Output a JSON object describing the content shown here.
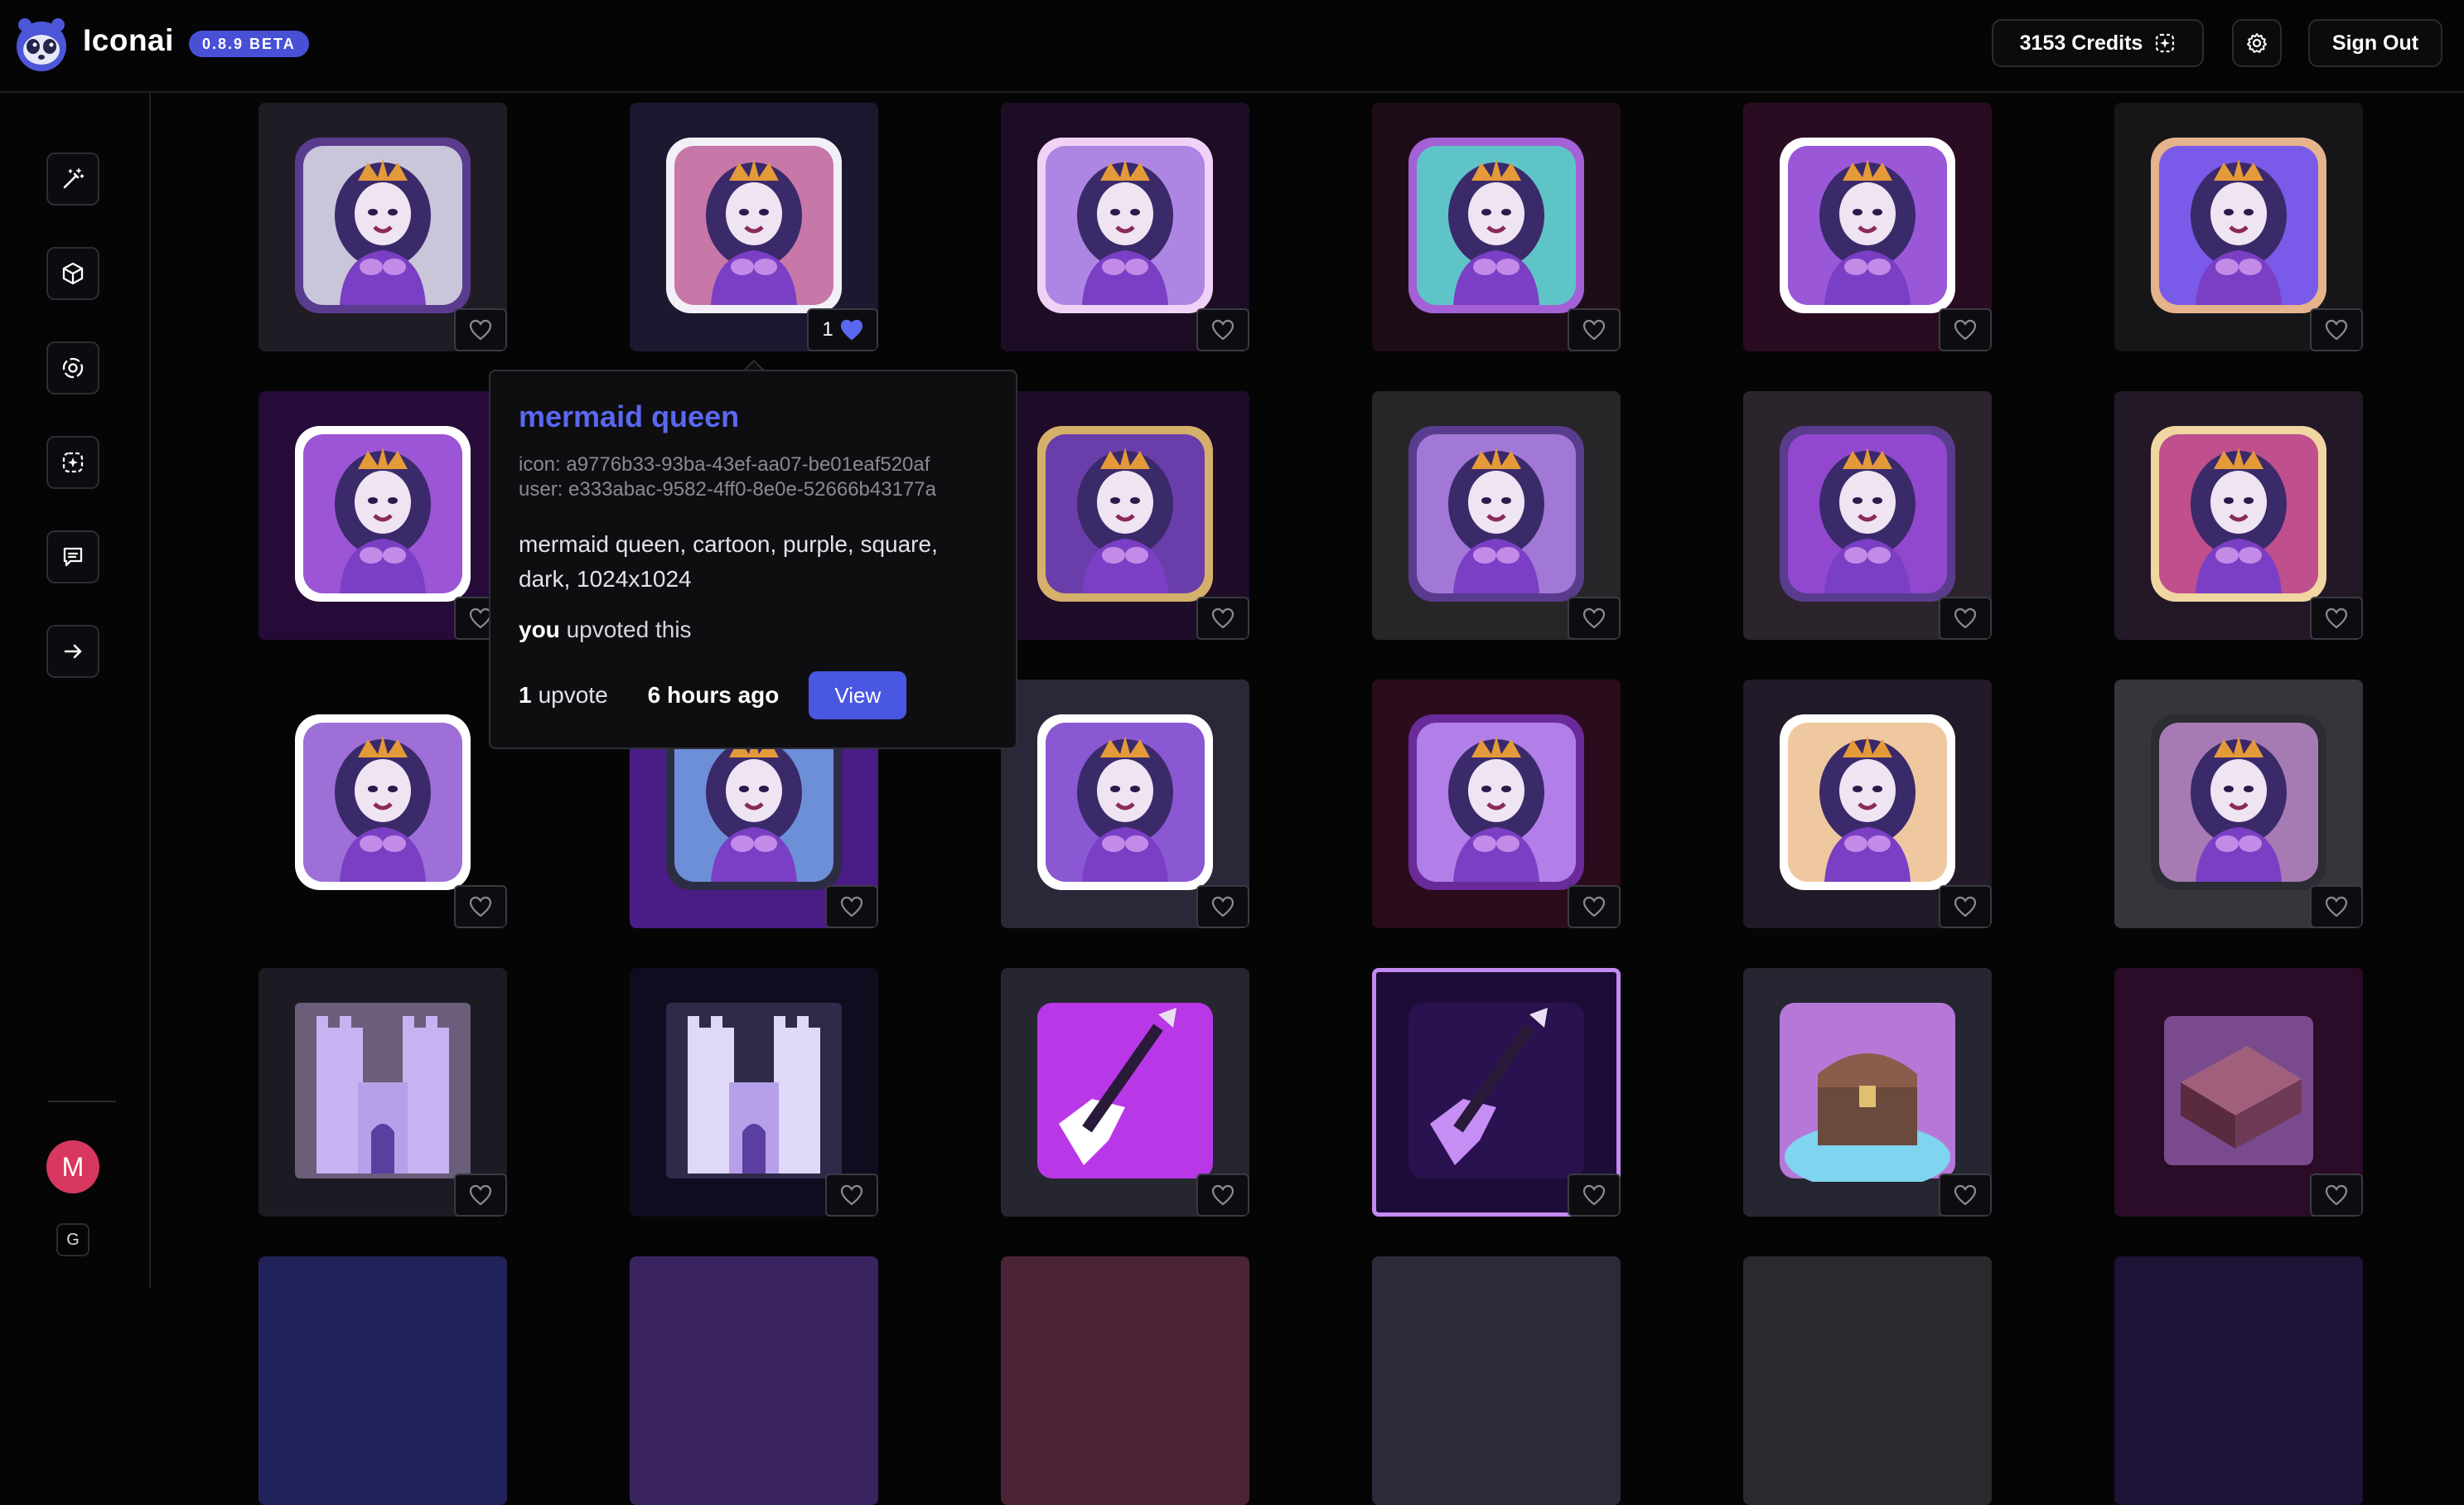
{
  "app": {
    "name": "Iconai",
    "version_badge": "0.8.9 BETA",
    "colors": {
      "accent": "#4a57e2",
      "background": "#050506",
      "avatar": "#d8385f"
    }
  },
  "header": {
    "credits_label": "3153 Credits",
    "credits_icon": "dashed-sparkle-icon",
    "settings_icon": "gear-icon",
    "signout_label": "Sign Out"
  },
  "sidebar": {
    "items": [
      {
        "name": "magic-wand-icon"
      },
      {
        "name": "cube-icon"
      },
      {
        "name": "aperture-icon"
      },
      {
        "name": "dashed-sparkle-icon"
      },
      {
        "name": "message-icon"
      },
      {
        "name": "arrow-right-icon"
      }
    ],
    "avatar_letter": "M",
    "footer_letter": "G"
  },
  "grid": {
    "icons": [
      {
        "subject": "mermaid",
        "bg": "#201c26",
        "tile": "#c9c6da",
        "accent": "#5a3c8e"
      },
      {
        "subject": "mermaid",
        "bg": "#1b1830",
        "tile": "#c777a8",
        "accent": "#f2f0f6",
        "votes": "1",
        "upvoted": true
      },
      {
        "subject": "mermaid",
        "bg": "#1d0d24",
        "tile": "#ad86e4",
        "accent": "#f0d2f6"
      },
      {
        "subject": "mermaid",
        "bg": "#1e0d18",
        "tile": "#5fc4c8",
        "accent": "#a461d6"
      },
      {
        "subject": "mermaid",
        "bg": "#2a0c22",
        "tile": "#9a58d8",
        "accent": "#ffffff"
      },
      {
        "subject": "mermaid",
        "bg": "#161618",
        "tile": "#7a5ae8",
        "accent": "#e5b38c"
      },
      {
        "subject": "mermaid",
        "bg": "#260a38",
        "tile": "#9c55d6",
        "accent": "#ffffff"
      },
      {
        "subject": "mermaid",
        "bg": "#1c0a2c",
        "tile": "#7b4ac8",
        "accent": "#ffffff"
      },
      {
        "subject": "mermaid",
        "bg": "#1e0c28",
        "tile": "#6a3eaa",
        "accent": "#d5b06a"
      },
      {
        "subject": "mermaid",
        "bg": "#262628",
        "tile": "#a178d6",
        "accent": "#5a3c8e"
      },
      {
        "subject": "mermaid",
        "bg": "#2c242c",
        "tile": "#9148cf",
        "accent": "#5a3c8e"
      },
      {
        "subject": "mermaid",
        "bg": "#221826",
        "tile": "#c04f8d",
        "accent": "#f0d6a0"
      },
      {
        "subject": "mermaid",
        "bg": "#050506",
        "tile": "#9d6fd7",
        "accent": "#ffffff"
      },
      {
        "subject": "mermaid",
        "bg": "#4a1c86",
        "tile": "#6d8fd8",
        "accent": "#2c2c44"
      },
      {
        "subject": "mermaid",
        "bg": "#282838",
        "tile": "#8a58d2",
        "accent": "#ffffff"
      },
      {
        "subject": "mermaid",
        "bg": "#2a0c1c",
        "tile": "#b27fe8",
        "accent": "#6a2a9a"
      },
      {
        "subject": "mermaid",
        "bg": "#221a28",
        "tile": "#f0c8a0",
        "accent": "#ffffff"
      },
      {
        "subject": "mermaid",
        "bg": "#36363a",
        "tile": "#a67ab2",
        "accent": "#2c2c34"
      },
      {
        "subject": "castle",
        "bg": "#1c1a22",
        "tile": "#6a5e7a",
        "accent": "#c7b2f2"
      },
      {
        "subject": "castle",
        "bg": "#0e0c1e",
        "tile": "#2e2a4a",
        "accent": "#e0d8f8"
      },
      {
        "subject": "guitar",
        "bg": "#262630",
        "tile": "#b838e8",
        "accent": "#ffffff"
      },
      {
        "subject": "guitar",
        "bg": "#1e0c38",
        "tile": "#2a1250",
        "accent": "#c68ef4",
        "selected": true
      },
      {
        "subject": "chest",
        "bg": "#262632",
        "tile": "#b678d8",
        "accent": "#6a4a3c"
      },
      {
        "subject": "box",
        "bg": "#2a0c28",
        "tile": "#7a4a8e",
        "accent": "#5a2a3e"
      }
    ],
    "partial_row_bgs": [
      "#22225a",
      "#3a2460",
      "#4a2436",
      "#2a2a3a",
      "#2a2a2e",
      "#1e1236"
    ]
  },
  "popover": {
    "title": "mermaid queen",
    "icon_id": "icon: a9776b33-93ba-43ef-aa07-be01eaf520af",
    "user_id": "user: e333abac-9582-4ff0-8e0e-52666b43177a",
    "description": "mermaid queen, cartoon, purple, square, dark, 1024x1024",
    "upvoter": "you",
    "upvote_text": "upvoted this",
    "upvote_count": "1",
    "upvote_word": "upvote",
    "time_ago": "6 hours ago",
    "view_label": "View"
  }
}
